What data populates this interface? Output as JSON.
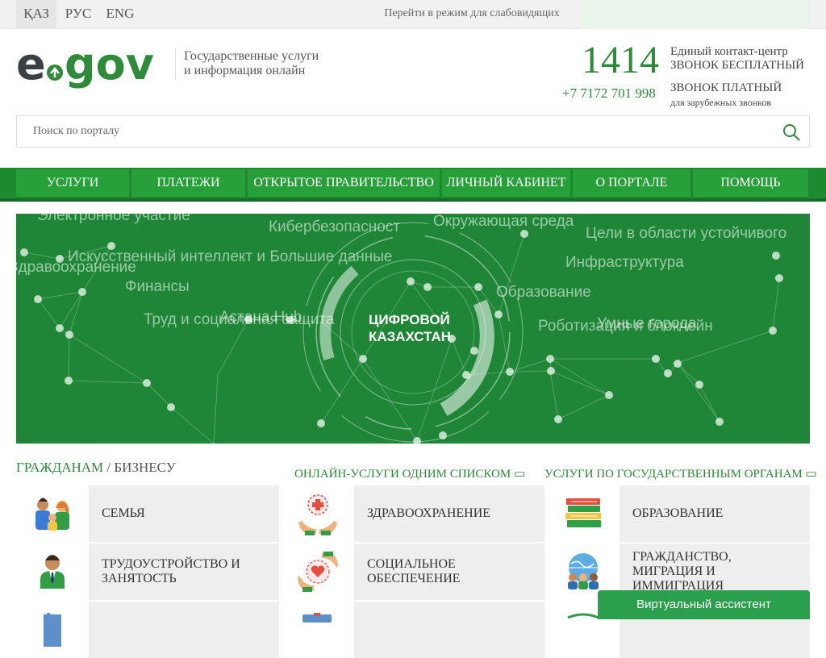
{
  "topbar": {
    "languages": [
      "ҚАЗ",
      "РУС",
      "ENG"
    ],
    "low_vision": "Перейти в режим для слабовидящих"
  },
  "header": {
    "tagline_line1": "Государственные услуги",
    "tagline_line2": "и информация онлайн",
    "phone_short": "1414",
    "phone_long": "+7 7172 701 998",
    "contact_center": "Единый контакт-центр",
    "call_free": "ЗВОНОК БЕСПЛАТНЫЙ",
    "call_paid": "ЗВОНОК ПЛАТНЫЙ",
    "foreign_calls": "для зарубежных звонков"
  },
  "search": {
    "placeholder": "Поиск по порталу"
  },
  "nav": [
    "УСЛУГИ",
    "ПЛАТЕЖИ",
    "ОТКРЫТОЕ ПРАВИТЕЛЬСТВО",
    "ЛИЧНЫЙ КАБИНЕТ",
    "О ПОРТАЛЕ",
    "ПОМОЩЬ"
  ],
  "banner": {
    "title_line1": "ЦИФРОВОЙ",
    "title_line2": "КАЗАХСТАН",
    "tags": [
      "Электронное участие",
      "Кибербезопасност",
      "Окружающая среда",
      "Цели в области устойчивого",
      "Искусственный интеллект и Большие данные",
      "Здравоохранение",
      "Инфраструктура",
      "Финансы",
      "Образование",
      "Труд и социальная защита",
      "Астана Hub",
      "Умные города",
      "Роботизация и блокчейн"
    ]
  },
  "section": {
    "citizens": "ГРАЖДАНАМ",
    "separator": "/",
    "business": "БИЗНЕСУ",
    "link_online": "ОНЛАЙН-УСЛУГИ ОДНИМ СПИСКОМ",
    "link_agencies": "УСЛУГИ ПО ГОСУДАРСТВЕННЫМ ОРГАНАМ"
  },
  "tiles": [
    {
      "label": "СЕМЬЯ",
      "icon": "family-icon"
    },
    {
      "label": "ЗДРАВООХРАНЕНИЕ",
      "icon": "health-icon"
    },
    {
      "label": "ОБРАЗОВАНИЕ",
      "icon": "books-icon"
    },
    {
      "label": "ТРУДОУСТРОЙСТВО И ЗАНЯТОСТЬ",
      "icon": "employee-icon"
    },
    {
      "label": "СОЦИАЛЬНОЕ ОБЕСПЕЧЕНИЕ",
      "icon": "social-care-icon"
    },
    {
      "label": "ГРАЖДАНСТВО, МИГРАЦИЯ И ИММИГРАЦИЯ",
      "icon": "globe-people-icon"
    }
  ],
  "assistant": "Виртуальный ассистент",
  "colors": {
    "brand_green": "#2e8b3a",
    "nav_green": "#27a03a",
    "banner_green": "#1e8636"
  }
}
